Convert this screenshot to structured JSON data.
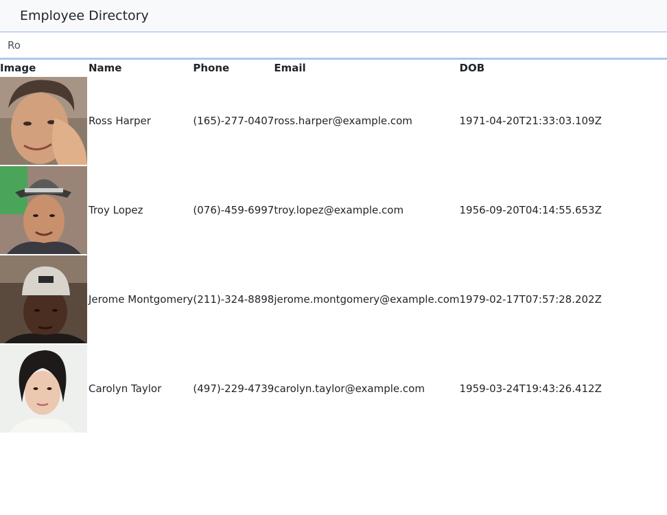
{
  "header": {
    "title": "Employee Directory"
  },
  "search": {
    "value": "Ro",
    "placeholder": ""
  },
  "table": {
    "columns": [
      "Image",
      "Name",
      "Phone",
      "Email",
      "DOB"
    ],
    "rows": [
      {
        "avatar": "person-photo-ross",
        "name": "Ross Harper",
        "phone": "(165)-277-0407",
        "email": "ross.harper@example.com",
        "dob": "1971-04-20T21:33:03.109Z"
      },
      {
        "avatar": "person-photo-troy",
        "name": "Troy Lopez",
        "phone": "(076)-459-6997",
        "email": "troy.lopez@example.com",
        "dob": "1956-09-20T04:14:55.653Z"
      },
      {
        "avatar": "person-photo-jerome",
        "name": "Jerome Montgomery",
        "phone": "(211)-324-8898",
        "email": "jerome.montgomery@example.com",
        "dob": "1979-02-17T07:57:28.202Z"
      },
      {
        "avatar": "person-photo-carolyn",
        "name": "Carolyn Taylor",
        "phone": "(497)-229-4739",
        "email": "carolyn.taylor@example.com",
        "dob": "1959-03-24T19:43:26.412Z"
      }
    ]
  }
}
